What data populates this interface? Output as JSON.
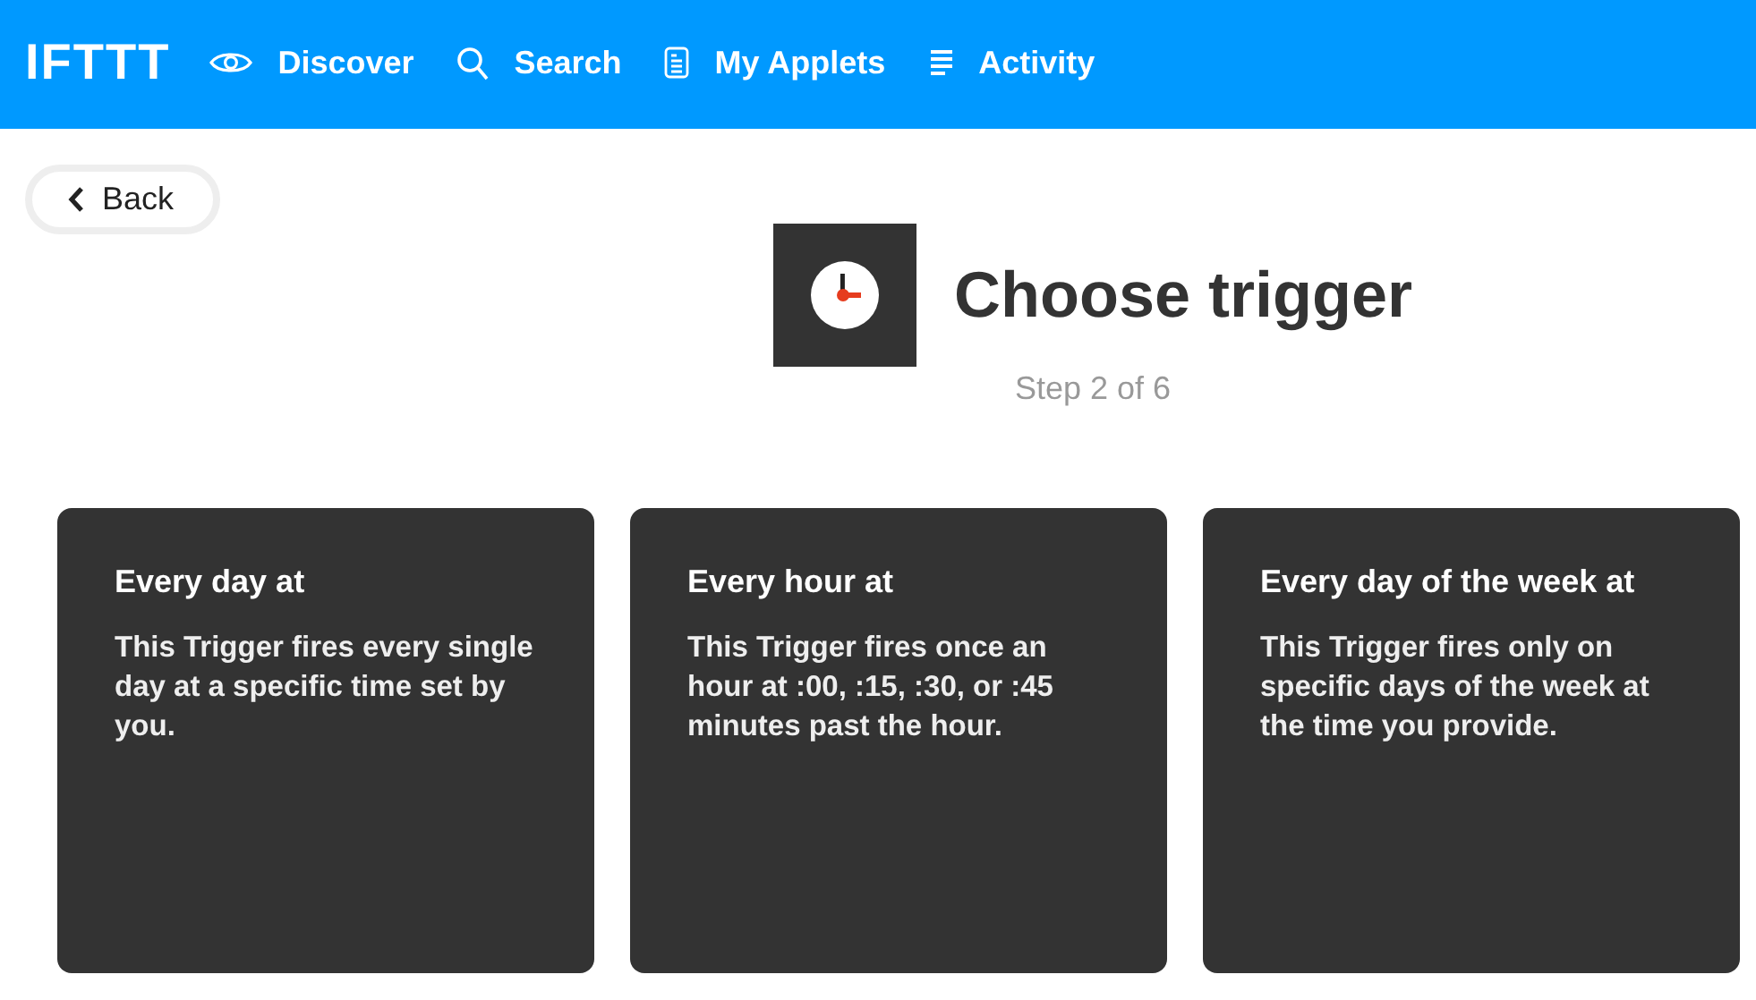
{
  "nav": {
    "logo": "IFTTT",
    "links": [
      {
        "kind": "discover",
        "label": "Discover"
      },
      {
        "kind": "search",
        "label": "Search"
      },
      {
        "kind": "applets",
        "label": "My Applets"
      },
      {
        "kind": "activity",
        "label": "Activity"
      }
    ]
  },
  "back_button": "Back",
  "heading": {
    "title": "Choose trigger",
    "step": "Step 2 of 6"
  },
  "triggers": [
    {
      "title": "Every day at",
      "description": "This Trigger fires every single day at a specific time set by you."
    },
    {
      "title": "Every hour at",
      "description": "This Trigger fires once an hour at :00, :15, :30, or :45 minutes past the hour."
    },
    {
      "title": "Every day of the week at",
      "description": "This Trigger fires only on specific days of the week at the time you provide."
    }
  ]
}
